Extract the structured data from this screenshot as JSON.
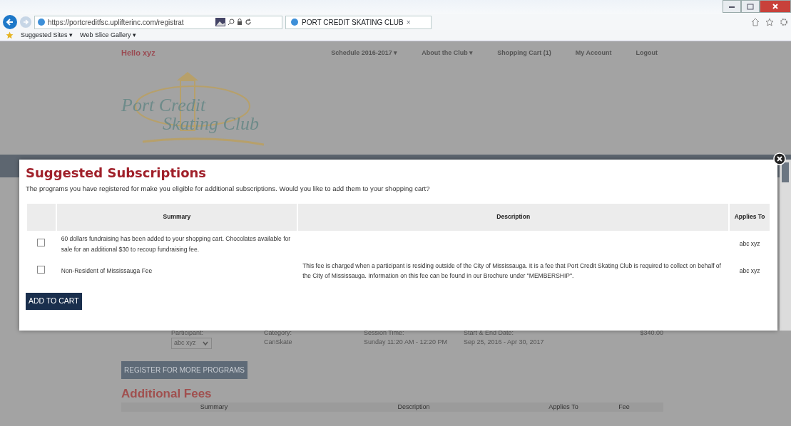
{
  "browser": {
    "address": "https://portcreditfsc.uplifterinc.com/registrat",
    "tab": {
      "label": "PORT CREDIT SKATING CLUB",
      "close": "×"
    },
    "favorites": [
      {
        "label": "Suggested Sites ▾"
      },
      {
        "label": "Web Slice Gallery ▾"
      }
    ]
  },
  "page": {
    "greeting": "Hello xyz",
    "nav": [
      {
        "label": "Schedule 2016-2017 ▾"
      },
      {
        "label": "About the Club ▾"
      },
      {
        "label": "Shopping Cart (1)"
      },
      {
        "label": "My Account"
      },
      {
        "label": "Logout"
      }
    ],
    "logo": {
      "line_1": "Port Credit",
      "line_2": "Skating Club"
    },
    "registration": {
      "fields": [
        {
          "label": "Participant:",
          "value": "abc xyz",
          "kind": "select"
        },
        {
          "label": "Category:",
          "value": "CanSkate",
          "kind": "text"
        },
        {
          "label": "Session Time:",
          "value": "Sunday 11:20 AM - 12:20 PM",
          "kind": "text"
        },
        {
          "label": "Start & End Date:",
          "value": "Sep 25, 2016 - Apr 30, 2017",
          "kind": "text"
        }
      ],
      "price": "$340.00"
    },
    "register_button": "REGISTER FOR MORE PROGRAMS",
    "additional_fees": {
      "title": "Additional Fees",
      "columns": [
        "Summary",
        "Description",
        "Applies To",
        "Fee"
      ]
    }
  },
  "modal": {
    "title": "Suggested Subscriptions",
    "intro": "The programs you have registered for make you eligible for additional subscriptions. Would you like to add them to your shopping cart?",
    "columns": [
      "Summary",
      "Description",
      "Applies To"
    ],
    "rows": [
      {
        "checked": false,
        "summary": "60 dollars fundraising has been added to your shopping cart. Chocolates available for sale for an additional $30 to recoup fundraising fee.",
        "description": "",
        "applies_to": "abc xyz"
      },
      {
        "checked": false,
        "summary": "Non-Resident of Mississauga Fee",
        "description": "This fee is charged when a participant is residing outside of the City of Mississauga.  It is a fee that Port Credit Skating Club is required to collect on behalf of the City of Mississauga.  Information on this fee can be found in our Brochure under \"MEMBERSHIP\".",
        "applies_to": "abc xyz"
      }
    ],
    "button": "ADD TO CART"
  }
}
